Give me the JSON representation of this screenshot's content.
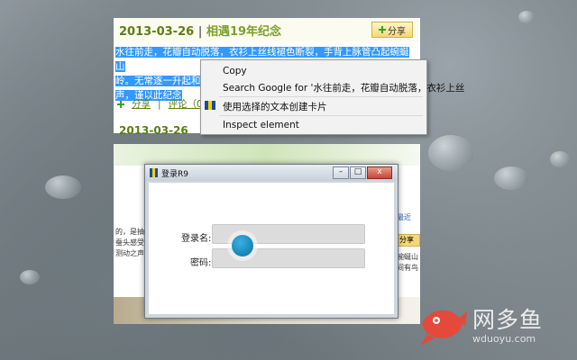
{
  "blog": {
    "date": "2013-03-26",
    "separator": "|",
    "title": "相遇19年纪念",
    "share_label": "分享",
    "selected_lines": [
      "水往前走，花瓣自动脱落，衣衫上丝线褪色断裂，手背上脉管凸起蜿蜒山",
      "岭。无常逐一升起和",
      "声，谨以此纪念"
    ],
    "actions": {
      "share": "分享",
      "sep": "|",
      "comments": "评论（0）"
    },
    "next_date": "2013-03-26"
  },
  "context_menu": {
    "items": [
      "Copy",
      "Search Google for '水往前走，花瓣自动脱落，衣衫上丝",
      "使用选择的文本创建卡片",
      "Inspect element"
    ]
  },
  "page2": {
    "side_texts": [
      "的，是抽夫",
      "蚕头感受",
      "测动之声。"
    ],
    "right_texts": [
      "最近",
      "蜿蜒山",
      "间有鸟"
    ],
    "share_small": "分享"
  },
  "login_window": {
    "title": "登录R9",
    "username_label": "登录名:",
    "password_label": "密码:",
    "username_value": "",
    "password_value": "",
    "buttons": {
      "minimize": "–",
      "maximize": "□",
      "close": "x"
    }
  },
  "logo": {
    "name": "网多鱼",
    "url": "wduoyu.com"
  },
  "colors": {
    "selection": "#3399ff",
    "blog_green": "#5a7f12",
    "cursor_blue": "#1a8fc4",
    "logo_red": "#e4493b"
  }
}
